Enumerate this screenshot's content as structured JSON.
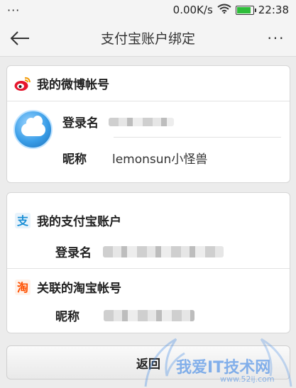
{
  "status_bar": {
    "menu_dots": "···",
    "network_speed": "0.00K/s",
    "time": "22:38",
    "battery_level": 0.9
  },
  "header": {
    "title": "支付宝账户绑定",
    "more_label": "···"
  },
  "weibo": {
    "section_title": "我的微博帐号",
    "login_label": "登录名",
    "nickname_label": "昵称",
    "nickname_value": "lemonsun小怪兽"
  },
  "alipay": {
    "section_title": "我的支付宝账户",
    "login_label": "登录名"
  },
  "taobao": {
    "section_title": "关联的淘宝帐号",
    "nickname_label": "昵称"
  },
  "actions": {
    "return_label": "返回"
  },
  "watermark": {
    "text": "我爱IT技术网",
    "url": "www.52ij.com"
  },
  "colors": {
    "weibo_red": "#e6162d",
    "alipay_blue": "#1a8fd6",
    "taobao_orange": "#ff5000"
  }
}
